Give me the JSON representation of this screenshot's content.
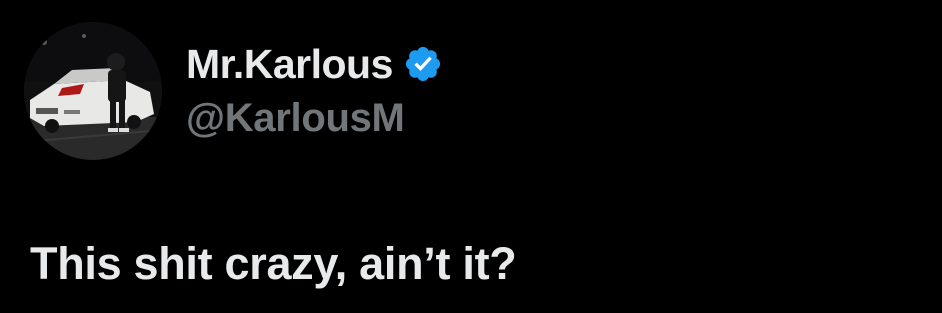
{
  "author": {
    "display_name": "Mr.Karlous",
    "handle": "@KarlousM",
    "verified": true,
    "avatar_icon": "profile-photo-car"
  },
  "tweet": {
    "text": "This shit crazy, ain’t it?"
  },
  "colors": {
    "background": "#000000",
    "primary_text": "#e7e9ea",
    "secondary_text": "#71767b",
    "verified_badge": "#1d9bf0"
  }
}
